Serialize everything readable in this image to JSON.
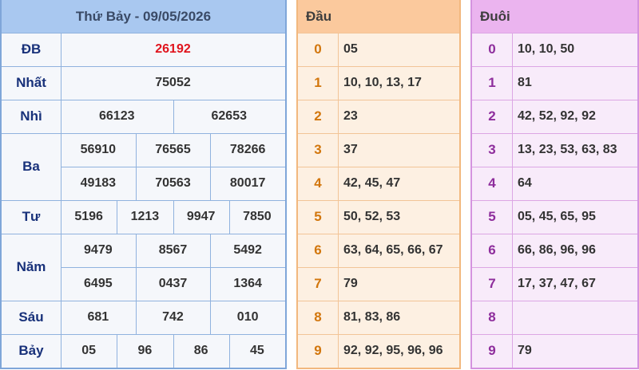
{
  "header": {
    "title": "Thứ Bảy - 09/05/2026"
  },
  "prizes": [
    {
      "label": "ĐB",
      "rows": [
        [
          "26192"
        ]
      ]
    },
    {
      "label": "Nhất",
      "rows": [
        [
          "75052"
        ]
      ]
    },
    {
      "label": "Nhì",
      "rows": [
        [
          "66123",
          "62653"
        ]
      ]
    },
    {
      "label": "Ba",
      "rows": [
        [
          "56910",
          "76565",
          "78266"
        ],
        [
          "49183",
          "70563",
          "80017"
        ]
      ]
    },
    {
      "label": "Tư",
      "rows": [
        [
          "5196",
          "1213",
          "9947",
          "7850"
        ]
      ]
    },
    {
      "label": "Năm",
      "rows": [
        [
          "9479",
          "8567",
          "5492"
        ],
        [
          "6495",
          "0437",
          "1364"
        ]
      ]
    },
    {
      "label": "Sáu",
      "rows": [
        [
          "681",
          "742",
          "010"
        ]
      ]
    },
    {
      "label": "Bảy",
      "rows": [
        [
          "05",
          "96",
          "86",
          "45"
        ]
      ]
    }
  ],
  "dau": {
    "title": "Đầu",
    "rows": [
      {
        "digit": "0",
        "values": "05"
      },
      {
        "digit": "1",
        "values": "10, 10, 13, 17"
      },
      {
        "digit": "2",
        "values": "23"
      },
      {
        "digit": "3",
        "values": "37"
      },
      {
        "digit": "4",
        "values": "42, 45, 47"
      },
      {
        "digit": "5",
        "values": "50, 52, 53"
      },
      {
        "digit": "6",
        "values": "63, 64, 65, 66, 67"
      },
      {
        "digit": "7",
        "values": "79"
      },
      {
        "digit": "8",
        "values": "81, 83, 86"
      },
      {
        "digit": "9",
        "values": "92, 92, 95, 96, 96"
      }
    ]
  },
  "duoi": {
    "title": "Đuôi",
    "rows": [
      {
        "digit": "0",
        "values": "10, 10, 50"
      },
      {
        "digit": "1",
        "values": "81"
      },
      {
        "digit": "2",
        "values": "42, 52, 92, 92"
      },
      {
        "digit": "3",
        "values": "13, 23, 53, 63, 83"
      },
      {
        "digit": "4",
        "values": "64"
      },
      {
        "digit": "5",
        "values": "05, 45, 65, 95"
      },
      {
        "digit": "6",
        "values": "66, 86, 96, 96"
      },
      {
        "digit": "7",
        "values": "17, 37, 47, 67"
      },
      {
        "digit": "8",
        "values": ""
      },
      {
        "digit": "9",
        "values": "79"
      }
    ]
  },
  "colors": {
    "special_prize": "#e0141d",
    "prize_label": "#18317a",
    "dau_digit": "#d2760c",
    "duoi_digit": "#8e2d9c"
  }
}
